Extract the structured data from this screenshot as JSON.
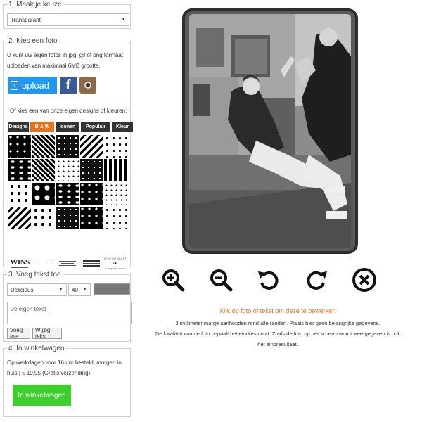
{
  "step1": {
    "title": "1. Maak je keuze",
    "select_value": "Transparant"
  },
  "step2": {
    "title": "2. Kies een foto",
    "intro_line1": "U kunt uw eigen fotos in jpg, gif of png formaat",
    "intro_line2": "uploaden van maximaal 6MB grootte.",
    "upload_label": "upload",
    "facebook_label": "f",
    "designs_intro": "Of kies een van onze eigen designs of kleuren:",
    "tabs": [
      {
        "label": "Designs",
        "active": false
      },
      {
        "label": "B & W",
        "active": true
      },
      {
        "label": "Iconen",
        "active": false
      },
      {
        "label": "Populair",
        "active": false
      },
      {
        "label": "Kleur",
        "active": false
      }
    ],
    "logos": [
      {
        "big": "WINS",
        "small": ""
      },
      {
        "big": "",
        "small": ""
      },
      {
        "big": "",
        "small": ""
      },
      {
        "big": "",
        "small": ""
      },
      {
        "big": "I PUT MY HEART",
        "small": "in airplane mode"
      }
    ]
  },
  "step3": {
    "title": "3. Voeg tekst toe",
    "font_value": "Delicious",
    "size_value": "40",
    "text_placeholder": "Je eigen tekst",
    "add_text_label": "Voeg toe",
    "edit_text_label": "Wijzig tekst",
    "text_color": "#777777"
  },
  "step4": {
    "title": "4. In winkelwagen",
    "delivery_line1": "Op werkdagen voor 16 uur besteld, morgen in",
    "delivery_line2": "huis | € 19,95 (Gratis verzending)",
    "cart_label": "In winkelwagen"
  },
  "preview": {
    "tools": [
      "zoom-in",
      "zoom-out",
      "rotate-left",
      "rotate-right",
      "remove"
    ],
    "edit_hint": "Klik op foto of tekst om deze te bewerken",
    "info_line1": "3 millimeter marge aanhouden rond alle randen. Plaats hier geen belangrijke gegevens.",
    "info_line2": "De kwaliteit van de foto bepaalt het eindresultaat. Zoals de foto op het scherm wordt weergegeven is ook",
    "info_line3": "het eindresultaat."
  },
  "colors": {
    "accent": "#e8711b",
    "upload": "#2196f3",
    "cart": "#3bd12a",
    "facebook": "#3b5998"
  }
}
